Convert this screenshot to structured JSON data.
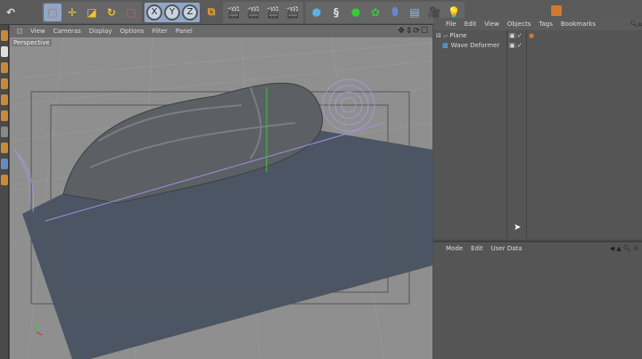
{
  "toolbar": {
    "axes": [
      "X",
      "Y",
      "Z"
    ]
  },
  "viewport": {
    "menu": [
      "View",
      "Cameras",
      "Display",
      "Options",
      "Filter",
      "Panel"
    ],
    "camera_label": "Perspective",
    "nav_icons": "✥⇕⟳☐"
  },
  "objects_panel": {
    "menu": [
      "File",
      "Edit",
      "View",
      "Objects",
      "Tags",
      "Bookmarks"
    ],
    "items": [
      {
        "name": "Plane"
      },
      {
        "name": "Wave Deformer"
      }
    ]
  },
  "attributes_panel": {
    "menu": [
      "Mode",
      "Edit",
      "User Data"
    ]
  },
  "colors": {
    "viewport_bg": "#8f8f8f",
    "plane": "#4c5563",
    "panel": "#555555"
  }
}
